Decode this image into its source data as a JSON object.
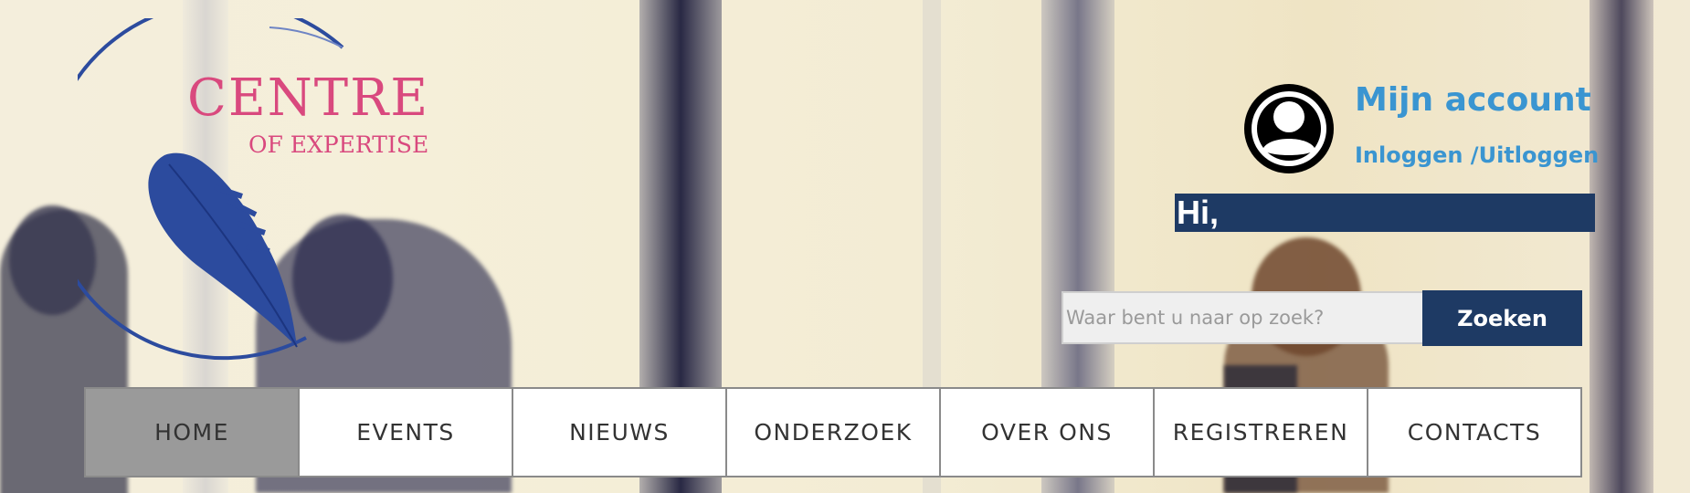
{
  "logo": {
    "title": "CENTRE",
    "subtitle": "OF EXPERTISE",
    "colors": {
      "text": "#d9497e",
      "feather": "#2c4b9e"
    }
  },
  "account": {
    "icon": "user-circle-icon",
    "title": "Mijn account",
    "login_label": "Inloggen /Uitloggen",
    "greeting": "Hi,"
  },
  "search": {
    "placeholder": "Waar bent u naar op zoek?",
    "value": "",
    "button_label": "Zoeken"
  },
  "nav": {
    "items": [
      {
        "label": "HOME",
        "active": true
      },
      {
        "label": "EVENTS",
        "active": false
      },
      {
        "label": "NIEUWS",
        "active": false
      },
      {
        "label": "ONDERZOEK",
        "active": false
      },
      {
        "label": "OVER ONS",
        "active": false
      },
      {
        "label": "REGISTREREN",
        "active": false
      },
      {
        "label": "CONTACTS",
        "active": false
      }
    ]
  },
  "colors": {
    "accent_blue": "#3a95d1",
    "navy": "#1e3a64",
    "nav_active": "#9a9a9a"
  }
}
